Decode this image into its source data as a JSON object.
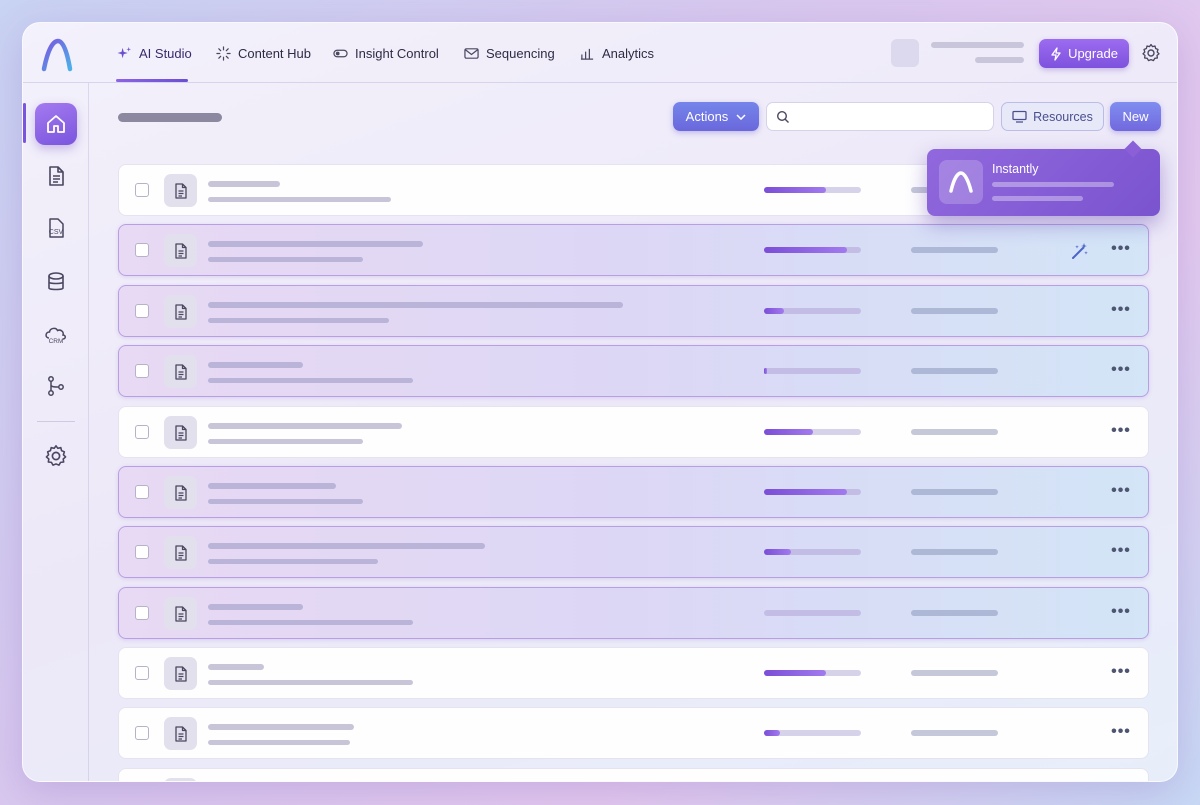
{
  "nav": {
    "tabs": [
      {
        "label": "AI Studio",
        "icon": "sparkle-icon",
        "active": true
      },
      {
        "label": "Content Hub",
        "icon": "burst-icon"
      },
      {
        "label": "Insight Control",
        "icon": "toggle-icon"
      },
      {
        "label": "Sequencing",
        "icon": "mail-icon"
      },
      {
        "label": "Analytics",
        "icon": "bar-chart-icon"
      }
    ],
    "upgrade_label": "Upgrade"
  },
  "sidebar": {
    "items": [
      {
        "icon": "home-icon",
        "active": true
      },
      {
        "icon": "document-icon"
      },
      {
        "icon": "csv-icon",
        "label": "CSV"
      },
      {
        "icon": "database-icon"
      },
      {
        "icon": "cloud-crm-icon",
        "label": "CRM"
      },
      {
        "icon": "workflow-icon"
      },
      {
        "icon": "settings-icon"
      }
    ]
  },
  "toolbar": {
    "actions_label": "Actions",
    "search_placeholder": "",
    "resources_label": "Resources",
    "new_label": "New"
  },
  "popover": {
    "title": "Instantly"
  },
  "rows": [
    {
      "progress": 0.64,
      "tinted": false
    },
    {
      "progress": 0.86,
      "tinted": true,
      "wand": true
    },
    {
      "progress": 0.21,
      "tinted": true
    },
    {
      "progress": 0.03,
      "tinted": true
    },
    {
      "progress": 0.51,
      "tinted": false
    },
    {
      "progress": 0.86,
      "tinted": true
    },
    {
      "progress": 0.28,
      "tinted": true
    },
    {
      "progress": 0.0,
      "tinted": true
    },
    {
      "progress": 0.64,
      "tinted": false
    },
    {
      "progress": 0.16,
      "tinted": false
    }
  ],
  "colors": {
    "accent": "#7a55dd",
    "actions": "#6f74e2",
    "popover": "#8560d6"
  }
}
